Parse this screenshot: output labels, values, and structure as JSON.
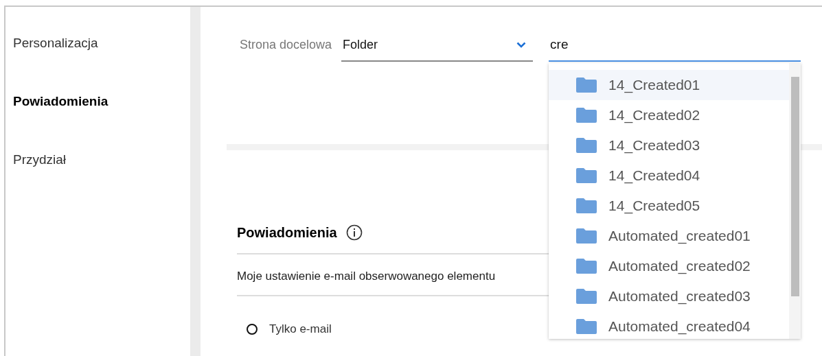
{
  "sidebar": {
    "items": [
      {
        "label": "Personalizacja",
        "selected": false
      },
      {
        "label": "Powiadomienia",
        "selected": true
      },
      {
        "label": "Przydział",
        "selected": false
      }
    ]
  },
  "landing": {
    "label": "Strona docelowa",
    "select_value": "Folder",
    "search_value": "cre"
  },
  "results": [
    {
      "name": "14_Created01",
      "selected": true
    },
    {
      "name": "14_Created02",
      "selected": false
    },
    {
      "name": "14_Created03",
      "selected": false
    },
    {
      "name": "14_Created04",
      "selected": false
    },
    {
      "name": "14_Created05",
      "selected": false
    },
    {
      "name": "Automated_created01",
      "selected": false
    },
    {
      "name": "Automated_created02",
      "selected": false
    },
    {
      "name": "Automated_created03",
      "selected": false
    },
    {
      "name": "Automated_created04",
      "selected": false
    }
  ],
  "notifications": {
    "title": "Powiadomienia",
    "setting_label": "Moje ustawienie e-mail obserwowanego elementu",
    "options": [
      {
        "label": "Tylko e-mail",
        "selected": false
      }
    ]
  }
}
